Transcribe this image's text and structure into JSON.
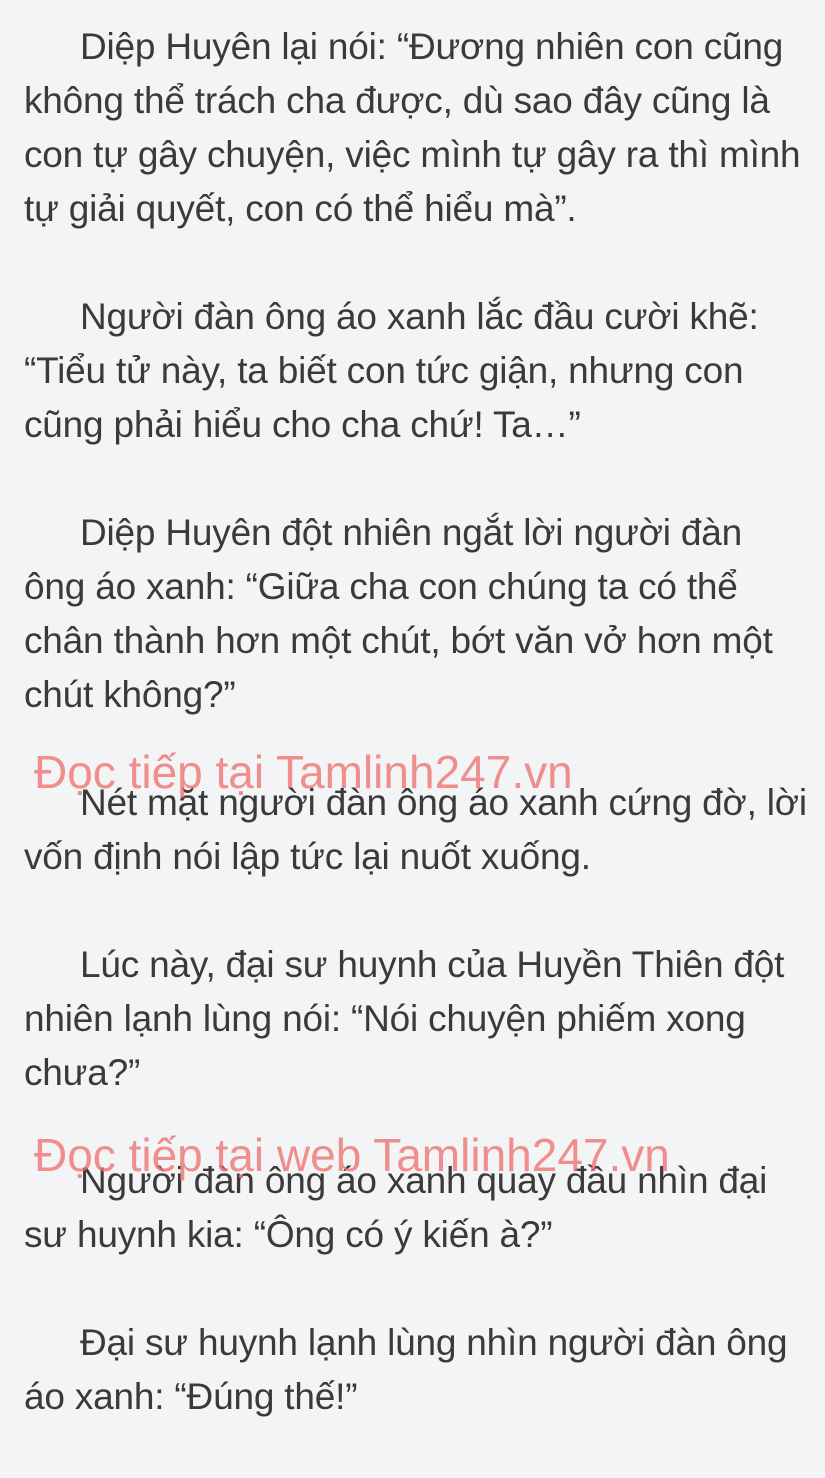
{
  "paragraphs": [
    "Diệp Huyên lại nói: “Đương nhiên con cũng không thể trách cha được, dù sao đây cũng là con tự gây chuyện, việc mình tự gây ra thì mình tự giải quyết, con có thể hiểu mà”.",
    "Người đàn ông áo xanh lắc đầu cười khẽ: “Tiểu tử này, ta biết con tức giận, nhưng con cũng phải hiểu cho cha chứ! Ta…”",
    "Diệp Huyên đột nhiên ngắt lời người đàn ông áo xanh: “Giữa cha con chúng ta có thể chân thành hơn một chút, bớt văn vở hơn một chút không?”",
    "Nét mặt người đàn ông áo xanh cứng đờ, lời vốn định nói lập tức lại nuốt xuống.",
    "Lúc này, đại sư huynh của Huyền Thiên đột nhiên lạnh lùng nói: “Nói chuyện phiếm xong chưa?”",
    "Người đàn ông áo xanh quay đầu nhìn đại sư huynh kia: “Ông có ý kiến à?”",
    "Đại sư huynh lạnh lùng nhìn người đàn ông áo xanh: “Đúng thế!”"
  ],
  "watermarks": [
    "Đọc tiếp tại Tamlinh247.vn",
    "Đọc tiếp tại web Tamlinh247.vn"
  ],
  "colors": {
    "background": "#f3f4f6",
    "text": "#3a3a3a",
    "watermark": "#ee7070"
  }
}
